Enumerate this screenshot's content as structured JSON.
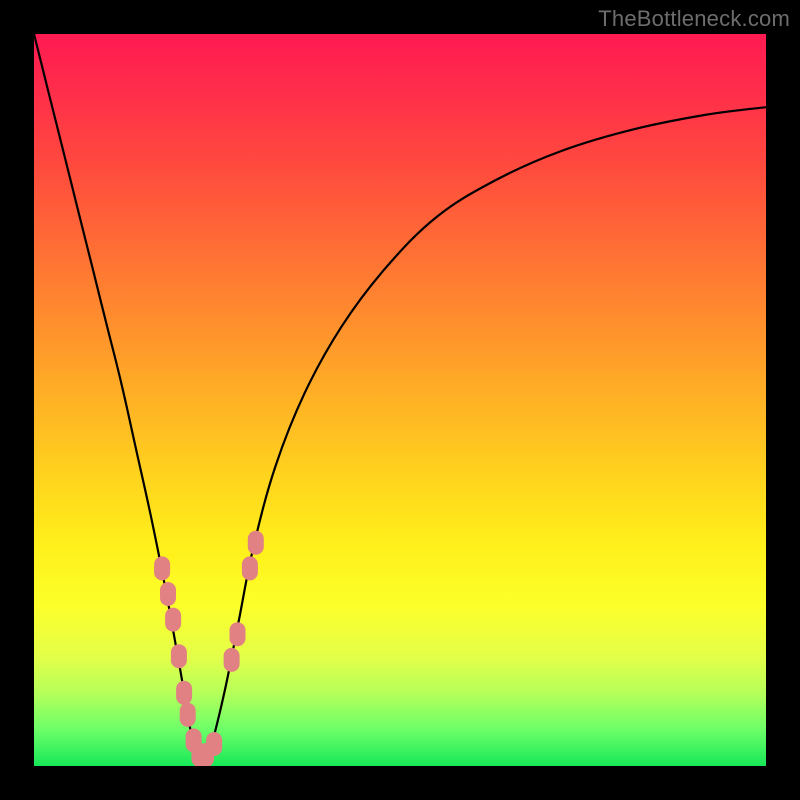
{
  "watermark": "TheBottleneck.com",
  "colors": {
    "frame": "#000000",
    "gradient_top": "#ff1a52",
    "gradient_mid_upper": "#ff8a2e",
    "gradient_mid_lower": "#fff01a",
    "gradient_bottom": "#17e858",
    "curve_stroke": "#000000",
    "marker_fill": "#e18183",
    "watermark_text": "#6d6d6d"
  },
  "chart_data": {
    "type": "line",
    "title": "",
    "xlabel": "",
    "ylabel": "",
    "xlim": [
      0,
      100
    ],
    "ylim": [
      0,
      100
    ],
    "series": [
      {
        "name": "bottleneck-curve",
        "x": [
          0,
          2,
          4,
          6,
          8,
          10,
          12,
          14,
          16,
          18,
          20,
          21,
          22,
          23,
          24,
          26,
          28,
          30,
          33,
          37,
          42,
          48,
          55,
          63,
          72,
          82,
          92,
          100
        ],
        "values": [
          100,
          92,
          84,
          76,
          68,
          60,
          52,
          43,
          34,
          24,
          13,
          7,
          2,
          0,
          2,
          10,
          20,
          30,
          41,
          51,
          60,
          68,
          75,
          80,
          84,
          87,
          89,
          90
        ]
      }
    ],
    "markers": {
      "name": "highlight-points",
      "shape": "rounded",
      "x": [
        17.5,
        18.3,
        19.0,
        19.8,
        20.5,
        21.0,
        21.8,
        22.6,
        23.5,
        24.6,
        27.0,
        27.8,
        29.5,
        30.3
      ],
      "values": [
        27.0,
        23.5,
        20.0,
        15.0,
        10.0,
        7.0,
        3.5,
        1.5,
        1.5,
        3.0,
        14.5,
        18.0,
        27.0,
        30.5
      ]
    }
  }
}
